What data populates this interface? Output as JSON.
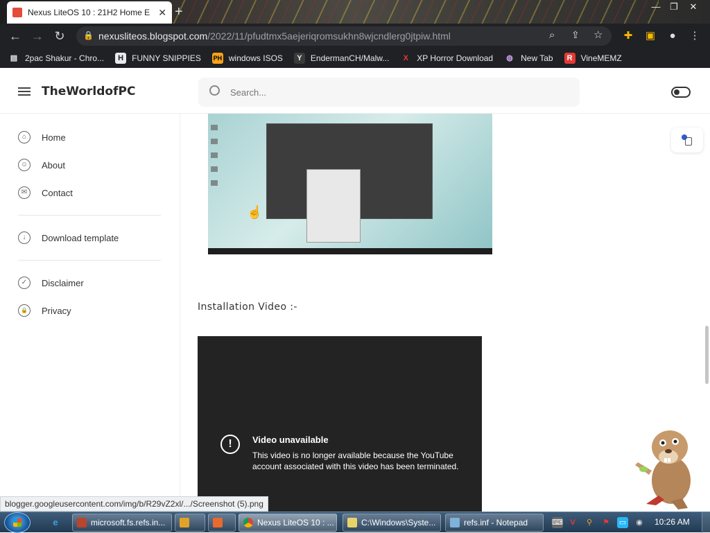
{
  "browser": {
    "tab_title": "Nexus LiteOS 10 : 21H2 Home E",
    "new_tab_symbol": "+",
    "url_host": "nexusliteos.blogspot.com",
    "url_path": "/2022/11/pfudtmx5aejeriqromsukhn8wjcndlerg0jtpiw.html"
  },
  "bookmarks": [
    {
      "label": "2pac Shakur - Chro...",
      "icon": "chrome-store-icon",
      "glyph": "▤",
      "color": "#e8eaed"
    },
    {
      "label": "FUNNY SNIPPIES",
      "icon": "h-icon",
      "glyph": "H",
      "color": "#e8eaed"
    },
    {
      "label": "windows ISOS",
      "icon": "ph-icon",
      "glyph": "PH",
      "color": "#f7a21b"
    },
    {
      "label": "EndermanCH/Malw...",
      "icon": "yt-icon",
      "glyph": "Y",
      "color": "#e8eaed"
    },
    {
      "label": "XP Horror Download",
      "icon": "x-icon",
      "glyph": "X",
      "color": "#e53935"
    },
    {
      "label": "New Tab",
      "icon": "globe-icon",
      "glyph": "◍",
      "color": "#e8eaed"
    },
    {
      "label": "VineMEMZ",
      "icon": "r-icon",
      "glyph": "R",
      "color": "#e53935"
    }
  ],
  "site": {
    "title": "TheWorldofPC",
    "search_placeholder": "Search..."
  },
  "sidebar": {
    "items": [
      {
        "label": "Home",
        "icon": "home-icon",
        "glyph": "⌂"
      },
      {
        "label": "About",
        "icon": "user-icon",
        "glyph": "☺"
      },
      {
        "label": "Contact",
        "icon": "mail-icon",
        "glyph": "✉"
      },
      {
        "label": "Download template",
        "icon": "download-icon",
        "glyph": "↓"
      },
      {
        "label": "Disclaimer",
        "icon": "shield-icon",
        "glyph": "✓"
      },
      {
        "label": "Privacy",
        "icon": "lock-icon",
        "glyph": "🔒"
      }
    ]
  },
  "content": {
    "installation_heading": "Installation Video :-",
    "video_title": "Video unavailable",
    "video_message": "This video is no longer available because the YouTube account associated with this video has been terminated.",
    "alert_symbol": "!"
  },
  "status_url": "blogger.googleusercontent.com/img/b/R29vZ2xl/.../Screenshot (5).png",
  "taskbar": {
    "tasks": [
      {
        "label": "microsoft.fs.refs.in...",
        "color": "#b9452e"
      },
      {
        "label": "",
        "color": "#e0a328"
      },
      {
        "label": "",
        "color": "#e86a2c"
      },
      {
        "label": "Nexus LiteOS 10 : ...",
        "color": "#4caf50"
      },
      {
        "label": "C:\\Windows\\Syste...",
        "color": "#e8d36a"
      },
      {
        "label": "refs.inf - Notepad",
        "color": "#7fb2d9"
      }
    ],
    "clock": "10:26 AM"
  }
}
